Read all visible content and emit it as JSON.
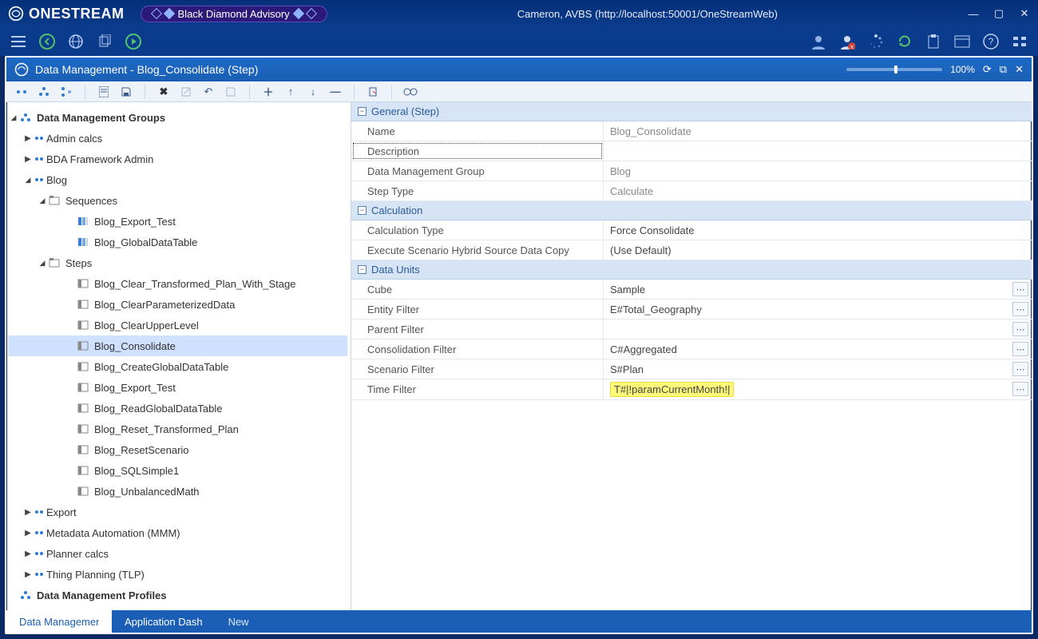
{
  "app": {
    "product": "ONESTREAM",
    "brand": "Black Diamond Advisory",
    "context": "Cameron, AVBS (http://localhost:50001/OneStreamWeb)"
  },
  "window": {
    "title": "Data Management - Blog_Consolidate (Step)",
    "zoom": "100%"
  },
  "tree": {
    "root": "Data Management Groups",
    "groups": [
      {
        "label": "Admin calcs"
      },
      {
        "label": "BDA Framework Admin"
      },
      {
        "label": "Blog",
        "expanded": true
      },
      {
        "label": "Export"
      },
      {
        "label": "Metadata Automation (MMM)"
      },
      {
        "label": "Planner calcs"
      },
      {
        "label": "Thing Planning (TLP)"
      }
    ],
    "blog": {
      "sequences_label": "Sequences",
      "sequences": [
        {
          "label": "Blog_Export_Test"
        },
        {
          "label": "Blog_GlobalDataTable"
        }
      ],
      "steps_label": "Steps",
      "steps": [
        {
          "label": "Blog_Clear_Transformed_Plan_With_Stage"
        },
        {
          "label": "Blog_ClearParameterizedData"
        },
        {
          "label": "Blog_ClearUpperLevel"
        },
        {
          "label": "Blog_Consolidate",
          "selected": true
        },
        {
          "label": "Blog_CreateGlobalDataTable"
        },
        {
          "label": "Blog_Export_Test"
        },
        {
          "label": "Blog_ReadGlobalDataTable"
        },
        {
          "label": "Blog_Reset_Transformed_Plan"
        },
        {
          "label": "Blog_ResetScenario"
        },
        {
          "label": "Blog_SQLSimple1"
        },
        {
          "label": "Blog_UnbalancedMath"
        }
      ]
    },
    "profiles": "Data Management Profiles"
  },
  "props": {
    "general": {
      "header": "General (Step)",
      "name_k": "Name",
      "name_v": "Blog_Consolidate",
      "desc_k": "Description",
      "desc_v": "",
      "dmg_k": "Data Management Group",
      "dmg_v": "Blog",
      "type_k": "Step Type",
      "type_v": "Calculate"
    },
    "calc": {
      "header": "Calculation",
      "ctype_k": "Calculation Type",
      "ctype_v": "Force Consolidate",
      "exec_k": "Execute Scenario Hybrid Source Data Copy",
      "exec_v": "(Use Default)"
    },
    "du": {
      "header": "Data Units",
      "cube_k": "Cube",
      "cube_v": "Sample",
      "ent_k": "Entity Filter",
      "ent_v": "E#Total_Geography",
      "par_k": "Parent Filter",
      "par_v": "",
      "con_k": "Consolidation Filter",
      "con_v": "C#Aggregated",
      "scn_k": "Scenario Filter",
      "scn_v": "S#Plan",
      "time_k": "Time Filter",
      "time_v": "T#|!paramCurrentMonth!|"
    }
  },
  "tabs": {
    "t1": "Data Management",
    "t2": "Application Dash",
    "t3": "New"
  }
}
